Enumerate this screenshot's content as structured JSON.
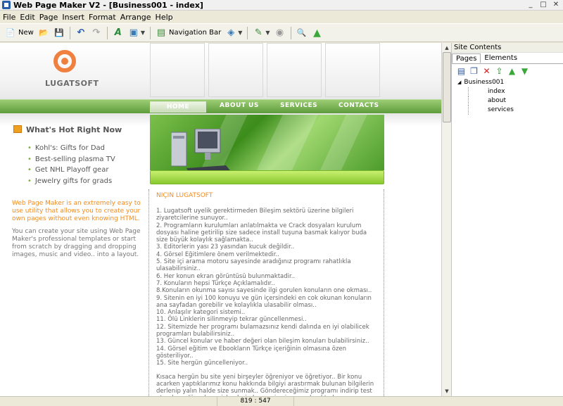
{
  "window": {
    "title": "Web Page Maker V2 - [Business001 - index]",
    "min_label": "_",
    "max_label": "□",
    "close_label": "✕"
  },
  "menu": [
    "File",
    "Edit",
    "Page",
    "Insert",
    "Format",
    "Arrange",
    "Help"
  ],
  "toolbar": {
    "new_label": "New",
    "navbar_label": "Navigation Bar",
    "dropdown_glyph": "▼"
  },
  "icons": {
    "new": "📄",
    "open": "📂",
    "save": "💾",
    "undo": "↶",
    "redo": "↷",
    "text": "A",
    "image": "▣",
    "navbar": "▤",
    "object": "◈",
    "edit": "✎",
    "globe": "◉",
    "zoom": "🔍",
    "up": "▲",
    "scroll_up": "▲",
    "scroll_down": "▼"
  },
  "panel": {
    "title": "Site Contents",
    "tabs": [
      "Pages",
      "Elements"
    ],
    "tools": [
      "▤",
      "❐",
      "✕",
      "⇪",
      "▲",
      "▼"
    ],
    "tree": {
      "root": "Business001",
      "children": [
        "index",
        "about",
        "services"
      ]
    }
  },
  "site": {
    "logo_text": "LUGATSOFT",
    "nav": [
      "HOME",
      "ABOUT US",
      "SERVICES",
      "CONTACTS"
    ],
    "hot_title": "What's Hot Right Now",
    "hot_items": [
      "Kohl's: Gifts for Dad",
      "Best-selling plasma TV",
      "Get NHL Playoff gear",
      "Jewelry gifts for grads"
    ],
    "promo1": "Web Page Maker is an extremely easy to use utility that allows you to create your own pages without even knowing HTML.",
    "promo2": "You can create your site using Web Page Maker's professional templates or start from scratch by dragging and dropping images, music and video.. into a layout.",
    "content_heading": "NIÇIN LUGATSOFT",
    "content_items": [
      "1. Lugatsoft uyelik gerektirmeden Bileşim sektörü üzerine bilgileri ziyaretcilerine sunuyor..",
      "2. Programların kurulumları anlatılmakta ve Crack dosyaları kurulum dosyası haline getirilip size sadece install tuşuna basmak kalıyor buda size büyük kolaylık sağlamakta..",
      "3. Editorlerin yası 23 yasından kucuk değildir..",
      "4. Görsel Eğitimlere önem verilmektedir..",
      "5. Site içi arama motoru sayesinde aradığınız programı rahatlıkla ulasabilirsiniz..",
      "6. Her konun ekran görüntüsü bulunmaktadir..",
      "7. Konuların hepsi Türkçe Açıklamalıdır..",
      "8.Konuların okunma sayısı sayesinde ilgi gorulen konuların one okması..",
      "9. Sitenin en iyi 100 konuyu ve gün içersindeki en cok okunan konuların ana sayfadan gorebilir ve kolaylıkla ulasabilir olması..",
      "10. Anlaşılır kategori sistemi..",
      "11. Ölü Linklerin silinmeyip tekrar güncellenmesi..",
      "12. Sitemizde her programı bulamazsınız kendi dalında en iyi olabilicek programları bulabilirsiniz..",
      "13. Güncel konular ve haber değeri olan bileşim konuları bulabilirsiniz..",
      "14. Görsel eğitim ve Ebookların Türkçe içeriğinin olmasına özen gösteriliyor..",
      "15. Site hergün güncelleniyor.."
    ],
    "content_para": "Kısaca hergün bu site yeni birşeyler öğreniyor ve öğretiyor.. Bir konu acarken yaptıklarımız konu hakkında bilgiyi arastırmak bulunan bilgilerin derlenip yalın halde size sunmak.. Göndereceğimiz programı indirip test etmek ve düzenleme işlemlerinden geçip size sunulmaktadır.."
  },
  "status": {
    "coordinates": "819 : 547"
  }
}
